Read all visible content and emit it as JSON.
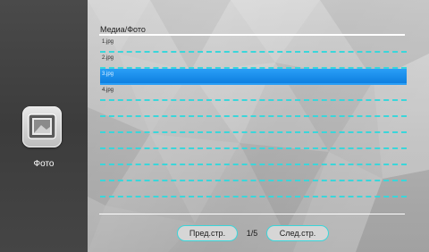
{
  "sidebar": {
    "active_item": {
      "label": "Фото",
      "icon": "photo-frame-icon"
    }
  },
  "main": {
    "title": "Медиа/Фото",
    "files": [
      {
        "name": "1.jpg",
        "selected": false
      },
      {
        "name": "2.jpg",
        "selected": false
      },
      {
        "name": "3.jpg",
        "selected": true
      },
      {
        "name": "4.jpg",
        "selected": false
      },
      {
        "name": "",
        "selected": false
      },
      {
        "name": "",
        "selected": false
      },
      {
        "name": "",
        "selected": false
      },
      {
        "name": "",
        "selected": false
      },
      {
        "name": "",
        "selected": false
      },
      {
        "name": "",
        "selected": false
      }
    ],
    "pager": {
      "prev_label": "Пред.стр.",
      "page_indicator": "1/5",
      "next_label": "След.стр."
    }
  },
  "colors": {
    "accent_cyan": "#3ad6da",
    "selection_blue": "#1a8ff0",
    "sidebar_bg": "#444444"
  }
}
